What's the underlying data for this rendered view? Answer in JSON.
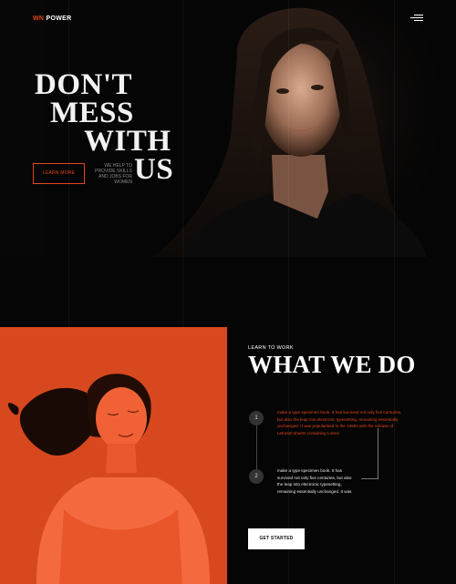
{
  "brand": {
    "accent": "WN",
    "rest": " POWER"
  },
  "nav": {
    "menu_icon": "hamburger-menu-icon"
  },
  "hero": {
    "headline_lines": [
      "DON'T",
      "MESS",
      "WITH",
      "US"
    ],
    "button_label": "LEARN MORE",
    "tagline": "WE HELP TO PROVIDE SKILLS AND JOBS FOR WOMEN"
  },
  "section": {
    "eyebrow": "LEARN TO WORK",
    "title": "WHAT WE DO",
    "steps": [
      {
        "number": "1",
        "text": "make a type specimen book. It has survived not only five centuries, but also the leap into electronic typesetting, remaining essentially unchanged. It was popularised in the 1960s with the release of Letraset sheets containing Lorem"
      },
      {
        "number": "2",
        "text": " make a type specimen book. It has survived not only five centuries, but also the leap into electronic typesetting, remaining essentially unchanged. It was"
      }
    ],
    "button_label": "GET STARTED"
  },
  "colors": {
    "accent": "#e2461c",
    "background": "#050505",
    "photo_tint": "#d8481e"
  }
}
